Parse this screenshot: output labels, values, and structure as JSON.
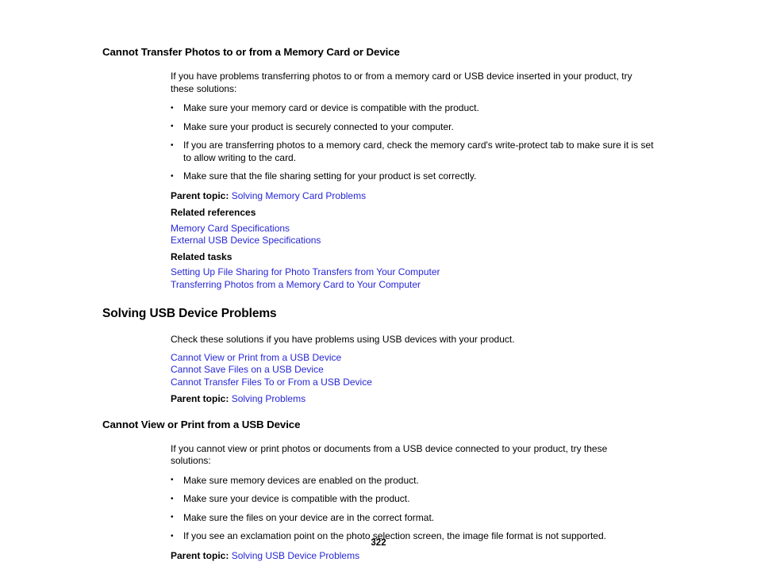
{
  "document": {
    "page_number": "322",
    "link_color": "#2727d6",
    "text_color": "#000000",
    "background_color": "#ffffff"
  },
  "sections": [
    {
      "heading": "Cannot Transfer Photos to or from a Memory Card or Device",
      "intro": "If you have problems transferring photos to or from a memory card or USB device inserted in your product, try these solutions:",
      "bullets": [
        "Make sure your memory card or device is compatible with the product.",
        "Make sure your product is securely connected to your computer.",
        "If you are transferring photos to a memory card, check the memory card's write-protect tab to make sure it is set to allow writing to the card.",
        "Make sure that the file sharing setting for your product is set correctly."
      ],
      "parent_topic_label": "Parent topic:",
      "parent_topic_link": "Solving Memory Card Problems",
      "related_references_label": "Related references",
      "related_references": [
        "Memory Card Specifications",
        "External USB Device Specifications"
      ],
      "related_tasks_label": "Related tasks",
      "related_tasks": [
        "Setting Up File Sharing for Photo Transfers from Your Computer",
        "Transferring Photos from a Memory Card to Your Computer"
      ]
    },
    {
      "heading": "Solving USB Device Problems",
      "intro": "Check these solutions if you have problems using USB devices with your product.",
      "child_links": [
        "Cannot View or Print from a USB Device",
        "Cannot Save Files on a USB Device",
        "Cannot Transfer Files To or From a USB Device"
      ],
      "parent_topic_label": "Parent topic:",
      "parent_topic_link": "Solving Problems"
    },
    {
      "heading": "Cannot View or Print from a USB Device",
      "intro": "If you cannot view or print photos or documents from a USB device connected to your product, try these solutions:",
      "bullets": [
        "Make sure memory devices are enabled on the product.",
        "Make sure your device is compatible with the product.",
        "Make sure the files on your device are in the correct format.",
        "If you see an exclamation point on the photo selection screen, the image file format is not supported."
      ],
      "parent_topic_label": "Parent topic:",
      "parent_topic_link": "Solving USB Device Problems"
    }
  ]
}
